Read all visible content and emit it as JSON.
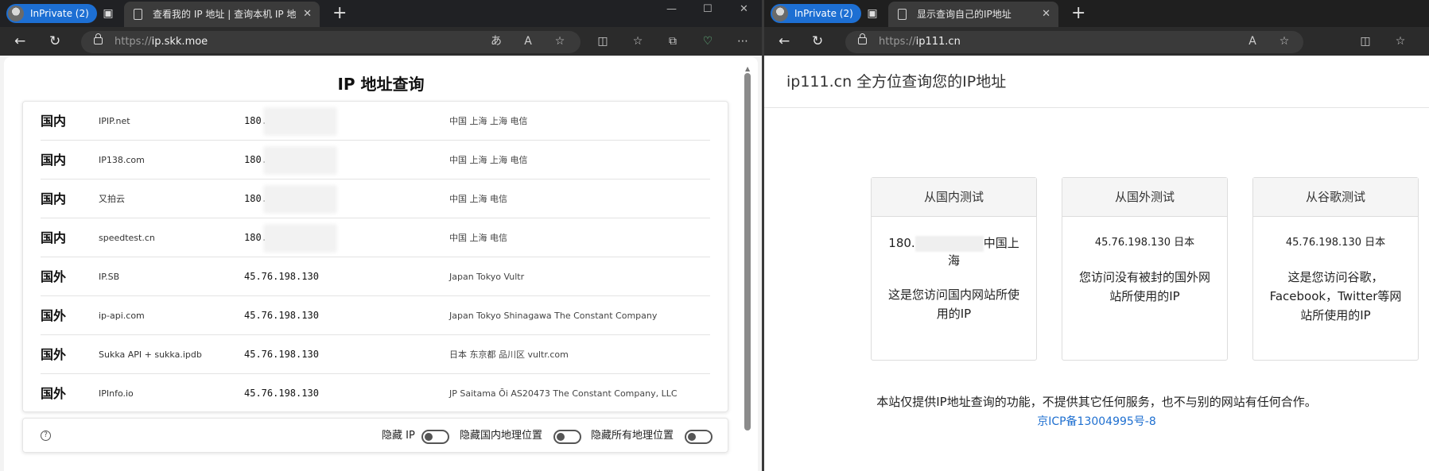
{
  "left": {
    "inprivate_label": "InPrivate (2)",
    "tab_title": "查看我的 IP 地址 | 查询本机 IP 地",
    "url_scheme": "https://",
    "url_host": "ip.skk.moe",
    "page_title": "IP 地址查询",
    "rows": [
      {
        "region": "国内",
        "source": "IPIP.net",
        "ip": "180.",
        "geo": "中国 上海 上海 电信"
      },
      {
        "region": "国内",
        "source": "IP138.com",
        "ip": "180.",
        "geo": "中国 上海 上海 电信"
      },
      {
        "region": "国内",
        "source": "又拍云",
        "ip": "180.",
        "geo": "中国 上海 电信"
      },
      {
        "region": "国内",
        "source": "speedtest.cn",
        "ip": "180.",
        "geo": "中国 上海 电信"
      },
      {
        "region": "国外",
        "source": "IP.SB",
        "ip": "45.76.198.130",
        "geo": "Japan Tokyo Vultr"
      },
      {
        "region": "国外",
        "source": "ip-api.com",
        "ip": "45.76.198.130",
        "geo": "Japan Tokyo Shinagawa The Constant Company"
      },
      {
        "region": "国外",
        "source": "Sukka API + sukka.ipdb",
        "ip": "45.76.198.130",
        "geo": "日本 东京都 品川区 vultr.com"
      },
      {
        "region": "国外",
        "source": "IPInfo.io",
        "ip": "45.76.198.130",
        "geo": "JP Saitama Ōi AS20473 The Constant Company, LLC"
      }
    ],
    "controls": {
      "help": "?",
      "hide_ip": "隐藏 IP",
      "hide_domestic_geo": "隐藏国内地理位置",
      "hide_all_geo": "隐藏所有地理位置"
    }
  },
  "right": {
    "inprivate_label": "InPrivate (2)",
    "tab_title": "显示查询自己的IP地址",
    "url_scheme": "https://",
    "url_host": "ip111.cn",
    "site_title": "ip111.cn 全方位查询您的IP地址",
    "panels": [
      {
        "title": "从国内测试",
        "ip_prefix": "180.",
        "ip_suffix": "中国上海",
        "desc": "这是您访问国内网站所使用的IP"
      },
      {
        "title": "从国外测试",
        "ip": "45.76.198.130 日本",
        "desc": "您访问没有被封的国外网站所使用的IP"
      },
      {
        "title": "从谷歌测试",
        "ip": "45.76.198.130 日本",
        "desc": "这是您访问谷歌，Facebook，Twitter等网站所使用的IP"
      }
    ],
    "footer": "本站仅提供IP地址查询的功能，不提供其它任何服务，也不与别的网站有任何合作。",
    "icp": "京ICP备13004995号-8"
  },
  "colors": {
    "accent": "#1d6fd3",
    "link": "#1e6fd0",
    "tabbar": "#202124"
  }
}
